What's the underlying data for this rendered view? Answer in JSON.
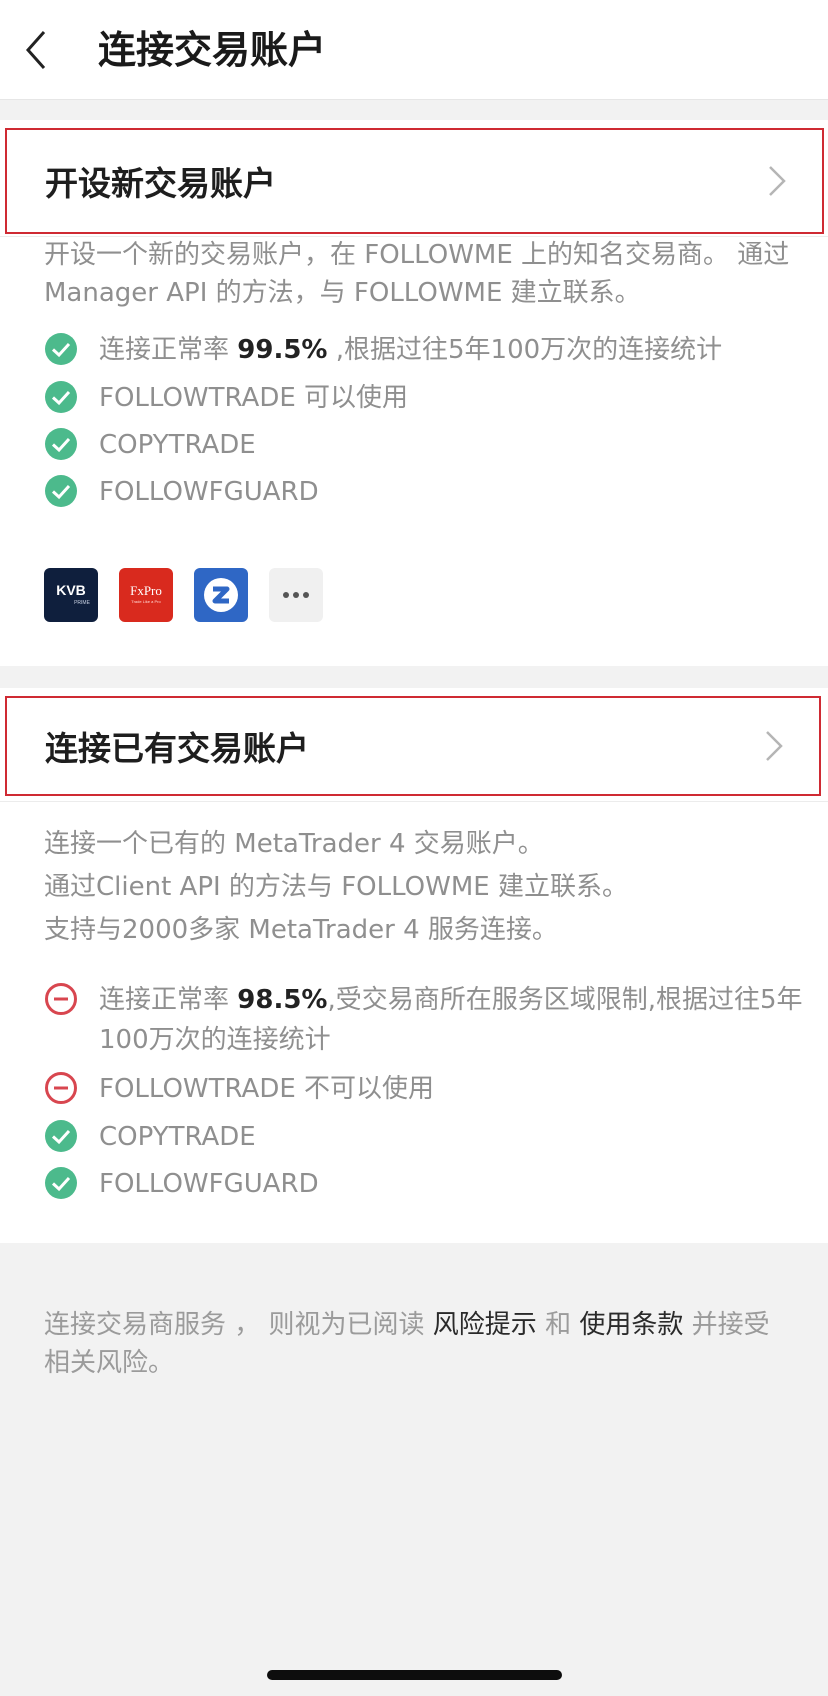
{
  "header": {
    "title": "连接交易账户",
    "back_icon": "chevron-left-icon"
  },
  "new_account": {
    "title": "开设新交易账户",
    "description": "开设一个新的交易账户，在 FOLLOWME 上的知名交易商。 通过 Manager API 的方法，与 FOLLOWME 建立联系。",
    "features": [
      {
        "status": "check",
        "prefix": "连接正常率 ",
        "highlight": "99.5%",
        "suffix": " ,根据过往5年100万次的连接统计"
      },
      {
        "status": "check",
        "prefix": "FOLLOWTRADE 可以使用",
        "highlight": "",
        "suffix": ""
      },
      {
        "status": "check",
        "prefix": "COPYTRADE",
        "highlight": "",
        "suffix": ""
      },
      {
        "status": "check",
        "prefix": "FOLLOWFGUARD",
        "highlight": "",
        "suffix": ""
      }
    ],
    "brokers": [
      {
        "name": "kvb-logo",
        "line1": "KVB",
        "line2": "PRIME"
      },
      {
        "name": "fxpro-logo",
        "line1": "FxPro",
        "line2": "Trade Like a Pro"
      },
      {
        "name": "zipmex-logo",
        "line1": "Z",
        "line2": ""
      },
      {
        "name": "more-brokers",
        "line1": "•••",
        "line2": ""
      }
    ]
  },
  "existing_account": {
    "title": "连接已有交易账户",
    "description_lines": [
      "连接一个已有的 MetaTrader 4 交易账户。",
      "通过Client API 的方法与 FOLLOWME 建立联系。",
      "支持与2000多家 MetaTrader 4 服务连接。"
    ],
    "features": [
      {
        "status": "minus",
        "prefix": "连接正常率 ",
        "highlight": "98.5%",
        "suffix": ",受交易商所在服务区域限制,根据过往5年100万次的连接统计"
      },
      {
        "status": "minus",
        "prefix": "FOLLOWTRADE 不可以使用",
        "highlight": "",
        "suffix": ""
      },
      {
        "status": "check",
        "prefix": "COPYTRADE",
        "highlight": "",
        "suffix": ""
      },
      {
        "status": "check",
        "prefix": "FOLLOWFGUARD",
        "highlight": "",
        "suffix": ""
      }
    ]
  },
  "footer": {
    "part1": "连接交易商服务 ， 则视为已阅读 ",
    "risk_link": "风险提示",
    "part2": " 和 ",
    "terms_link": "使用条款",
    "part3": " 并接受相关风险。"
  },
  "colors": {
    "check": "#4cba8c",
    "minus": "#d8464f",
    "highlight_border": "#cf2a33"
  }
}
